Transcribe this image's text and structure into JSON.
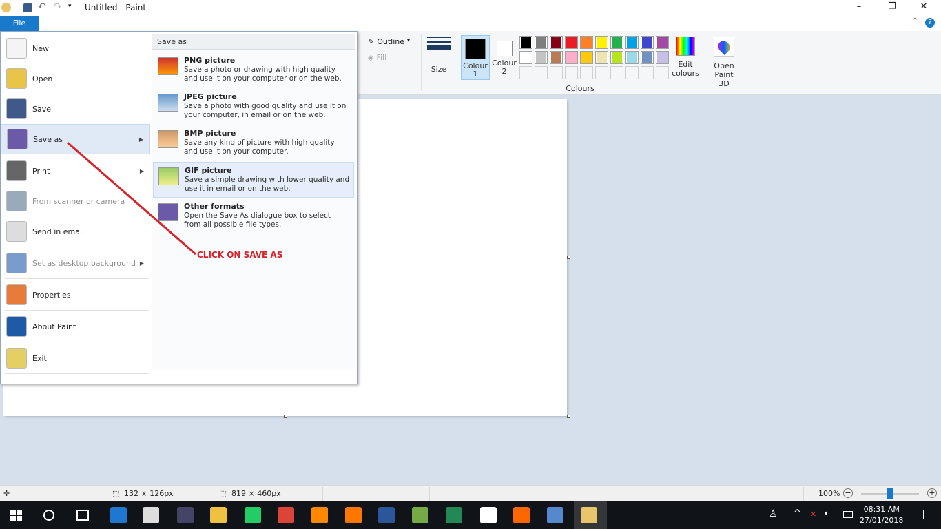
{
  "window": {
    "title": "Untitled - Paint",
    "minimize": "–",
    "maximize": "❐",
    "close": "✕",
    "help": "?",
    "collapse": "^"
  },
  "file_tab": "File",
  "ribbon": {
    "outline": "Outline",
    "fill": "Fill",
    "size": "Size",
    "colour1": "Colour 1",
    "colour2": "Colour 2",
    "edit_colours": "Edit colours",
    "open_paint3d": "Open Paint 3D",
    "colours_group": "Colours",
    "palette_row1": [
      "#000000",
      "#7f7f7f",
      "#880015",
      "#ed1c24",
      "#ff7f27",
      "#fff200",
      "#22b14c",
      "#00a2e8",
      "#3f48cc",
      "#a349a4"
    ],
    "palette_row2": [
      "#ffffff",
      "#c3c3c3",
      "#b97a57",
      "#ffaec9",
      "#ffc90e",
      "#efe4b0",
      "#b5e61d",
      "#99d9ea",
      "#7092be",
      "#c8bfe7"
    ]
  },
  "menu": {
    "items": [
      {
        "label": "New",
        "icon": "new-file-icon"
      },
      {
        "label": "Open",
        "icon": "open-folder-icon"
      },
      {
        "label": "Save",
        "icon": "save-disk-icon"
      },
      {
        "label": "Save as",
        "icon": "save-as-icon"
      },
      {
        "label": "Print",
        "icon": "printer-icon"
      },
      {
        "label": "From scanner or camera",
        "icon": "scanner-icon"
      },
      {
        "label": "Send in email",
        "icon": "email-icon"
      },
      {
        "label": "Set as desktop background",
        "icon": "desktop-icon"
      },
      {
        "label": "Properties",
        "icon": "checkmark-icon"
      },
      {
        "label": "About Paint",
        "icon": "info-icon"
      },
      {
        "label": "Exit",
        "icon": "exit-icon"
      }
    ],
    "save_as_header": "Save as",
    "save_as_options": [
      {
        "title": "PNG picture",
        "desc": "Save a photo or drawing with high quality and use it on your computer or on the web."
      },
      {
        "title": "JPEG picture",
        "desc": "Save a photo with good quality and use it on your computer, in email or on the web."
      },
      {
        "title": "BMP picture",
        "desc": "Save any kind of picture with high quality and use it on your computer."
      },
      {
        "title": "GIF picture",
        "desc": "Save a simple drawing with lower quality and use it in email or on the web."
      },
      {
        "title": "Other formats",
        "desc": "Open the Save As dialogue box to select from all possible file types."
      }
    ]
  },
  "annotation": "CLICK ON SAVE AS",
  "status": {
    "selection": "132 × 126px",
    "canvas_size": "819 × 460px",
    "zoom": "100%"
  },
  "taskbar": {
    "time": "08:31 AM",
    "date": "27/01/2018"
  }
}
